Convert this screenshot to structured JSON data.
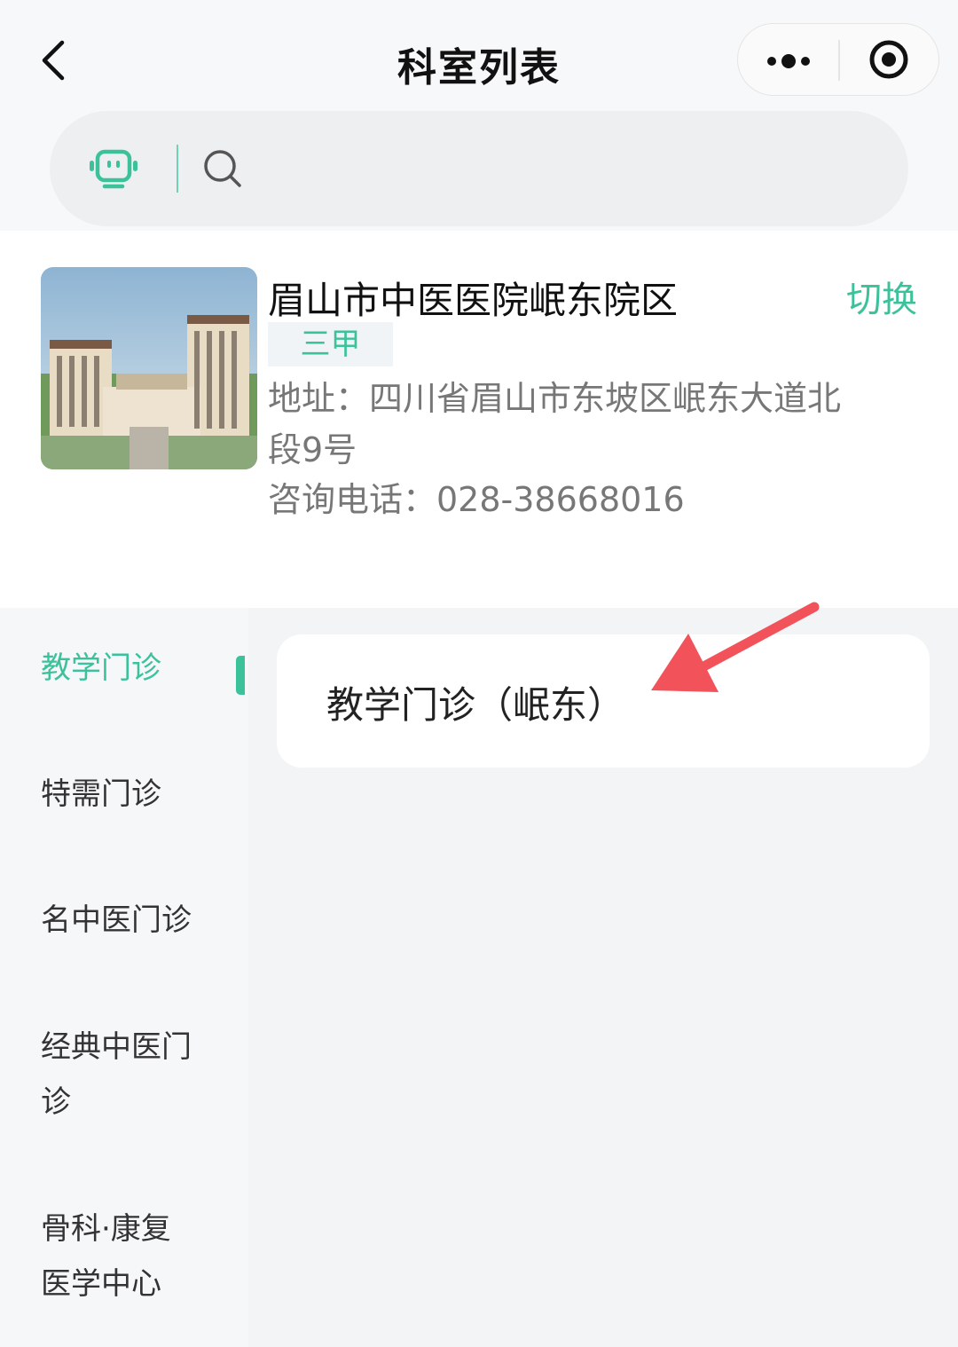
{
  "nav": {
    "title": "科室列表"
  },
  "hospital": {
    "name": "眉山市中医医院岷东院区",
    "switch_label": "切换",
    "level": "三甲",
    "address": "地址：四川省眉山市东坡区岷东大道北段9号",
    "phone": "咨询电话：028-38668016"
  },
  "sidebar": {
    "items": [
      {
        "label": "教学门诊",
        "active": true
      },
      {
        "label": "特需门诊"
      },
      {
        "label": "名中医门诊"
      },
      {
        "label": "经典中医门诊"
      },
      {
        "label": "骨科·康复医学中心"
      }
    ]
  },
  "departments": [
    {
      "label": "教学门诊（岷东）"
    }
  ],
  "colors": {
    "accent": "#3cc29a",
    "arrow": "#f2525a"
  }
}
